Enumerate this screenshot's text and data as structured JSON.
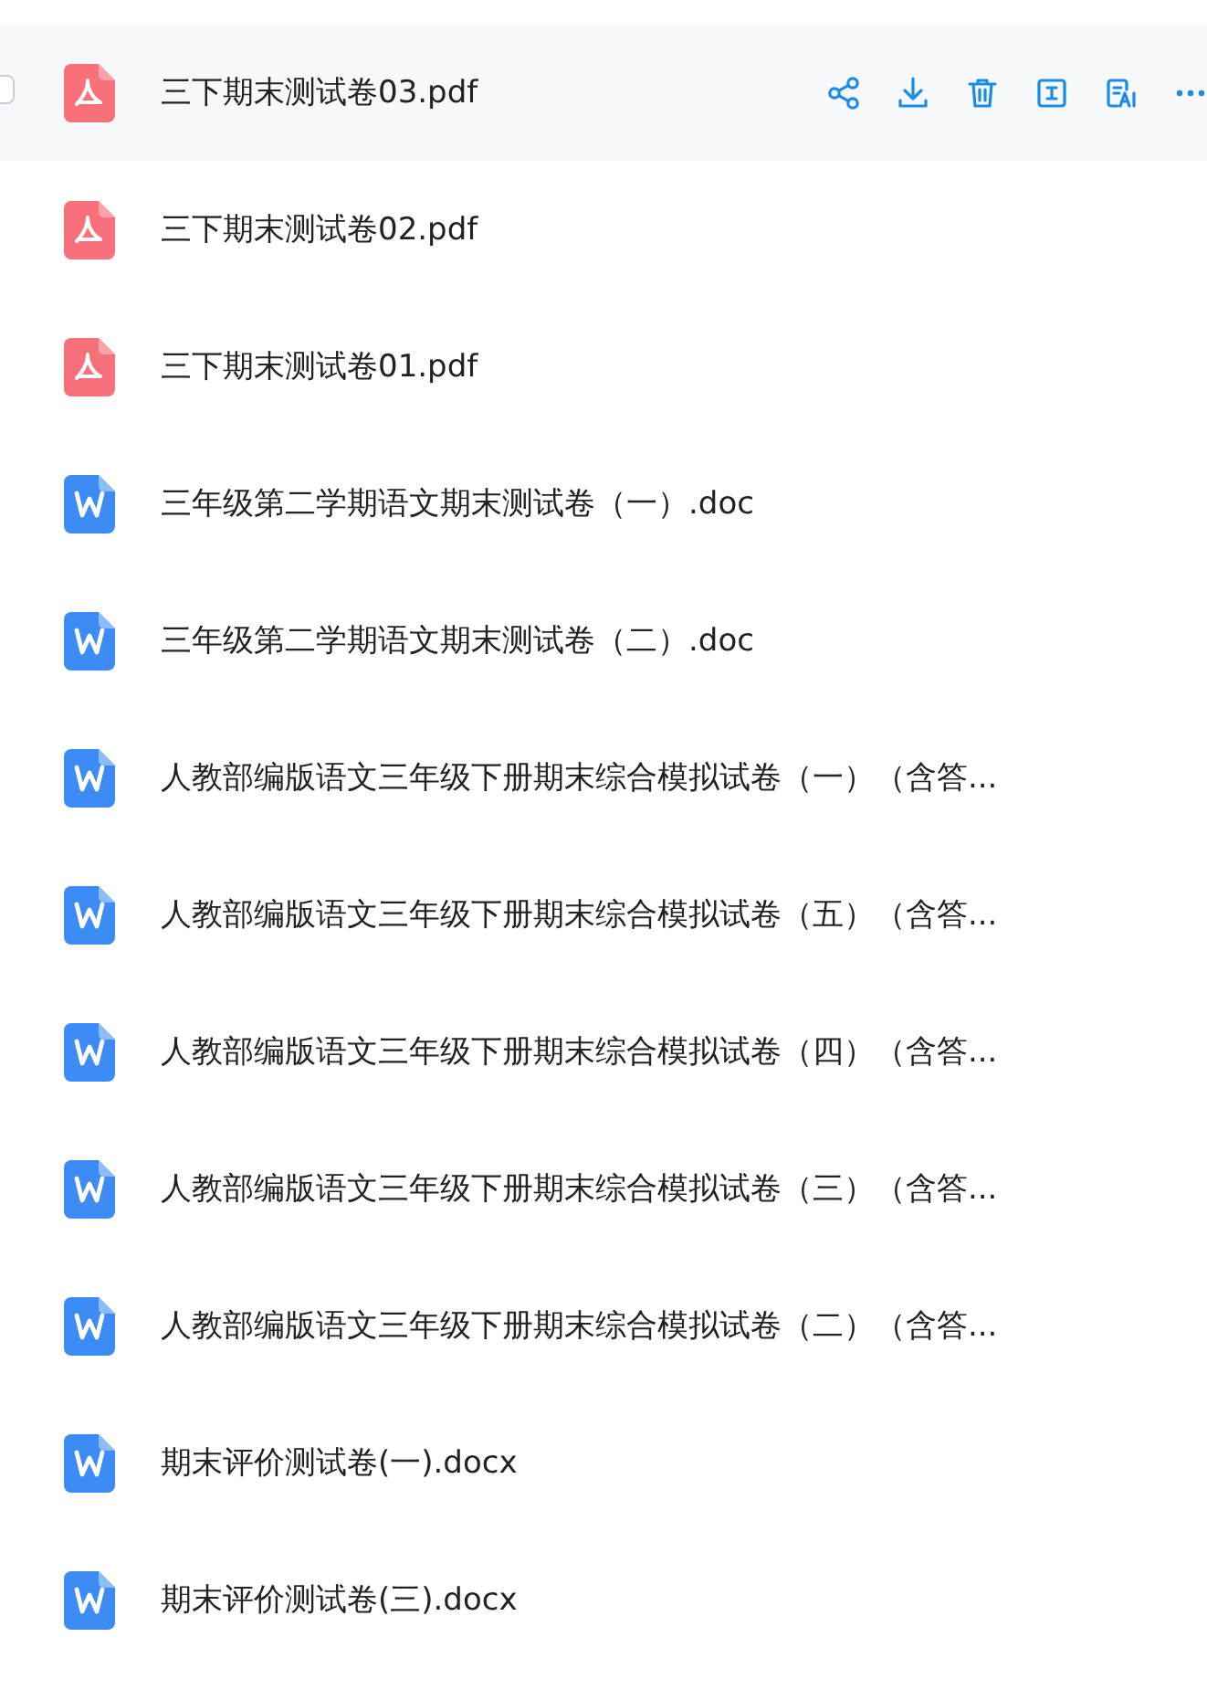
{
  "files": [
    {
      "kind": "pdf",
      "name": "三下期末测试卷03.pdf",
      "hovered": true,
      "checked": false
    },
    {
      "kind": "pdf",
      "name": "三下期末测试卷02.pdf",
      "hovered": false
    },
    {
      "kind": "pdf",
      "name": "三下期末测试卷01.pdf",
      "hovered": false
    },
    {
      "kind": "word",
      "name": "三年级第二学期语文期末测试卷（一）.doc",
      "hovered": false
    },
    {
      "kind": "word",
      "name": "三年级第二学期语文期末测试卷（二）.doc",
      "hovered": false
    },
    {
      "kind": "word",
      "name": "人教部编版语文三年级下册期末综合模拟试卷（一）（含答...",
      "hovered": false
    },
    {
      "kind": "word",
      "name": "人教部编版语文三年级下册期末综合模拟试卷（五）（含答...",
      "hovered": false
    },
    {
      "kind": "word",
      "name": "人教部编版语文三年级下册期末综合模拟试卷（四）（含答...",
      "hovered": false
    },
    {
      "kind": "word",
      "name": "人教部编版语文三年级下册期末综合模拟试卷（三）（含答...",
      "hovered": false
    },
    {
      "kind": "word",
      "name": "人教部编版语文三年级下册期末综合模拟试卷（二）（含答...",
      "hovered": false
    },
    {
      "kind": "word",
      "name": "期末评价测试卷(一).docx",
      "hovered": false
    },
    {
      "kind": "word",
      "name": "期末评价测试卷(三).docx",
      "hovered": false
    }
  ]
}
